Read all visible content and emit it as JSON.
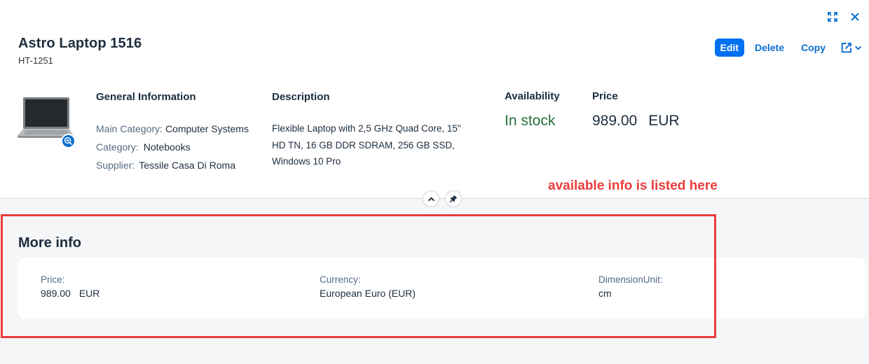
{
  "header": {
    "title": "Astro Laptop 1516",
    "subtitle": "HT-1251",
    "actions": {
      "edit": "Edit",
      "delete": "Delete",
      "copy": "Copy"
    },
    "window_icons": [
      "fullscreen-icon",
      "close-icon"
    ]
  },
  "general_info": {
    "heading": "General Information",
    "main_category_label": "Main Category:",
    "main_category_value": "Computer Systems",
    "category_label": "Category:",
    "category_value": "Notebooks",
    "supplier_label": "Supplier:",
    "supplier_value": "Tessile Casa Di Roma"
  },
  "description": {
    "heading": "Description",
    "line1": "Flexible Laptop with 2,5 GHz Quad Core, 15\"",
    "line2": "HD TN, 16 GB DDR SDRAM, 256 GB SSD,",
    "line3": "Windows 10 Pro"
  },
  "availability": {
    "heading": "Availability",
    "value": "In stock"
  },
  "price": {
    "heading": "Price",
    "amount": "989.00",
    "currency": "EUR"
  },
  "annotation": "available info is listed here",
  "more_info": {
    "title": "More info",
    "fields": [
      {
        "label": "Price:",
        "value": "989.00",
        "unit": "EUR"
      },
      {
        "label": "Currency:",
        "value": "European Euro (EUR)"
      },
      {
        "label": "DimensionUnit:",
        "value": "cm"
      }
    ]
  },
  "colors": {
    "accent": "#0a6ed1",
    "primary_button": "#0070f2",
    "in_stock": "#256f3a",
    "annotation": "#ea3c3c"
  }
}
